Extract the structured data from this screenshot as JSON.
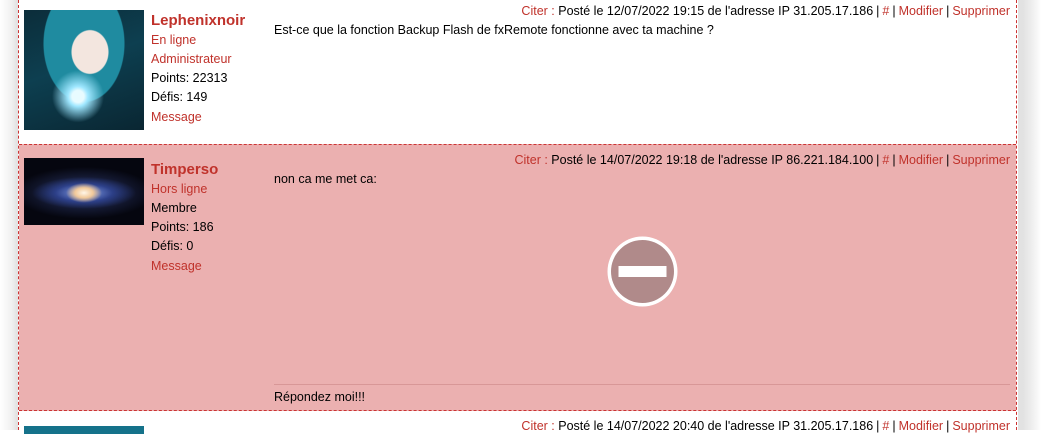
{
  "posts": [
    {
      "username": "Lephenixnoir",
      "status": "En ligne",
      "role": "Administrateur",
      "points": "Points: 22313",
      "defis": "Défis: 149",
      "message_link": "Message",
      "cite": "Citer :",
      "posted": "Posté le 12/07/2022 19:15 de l'adresse IP 31.205.17.186",
      "sep": "|",
      "hash": "#",
      "edit": "Modifier",
      "delete": "Supprimer",
      "text": "Est-ce que la fonction Backup Flash de fxRemote fonctionne avec ta machine ?"
    },
    {
      "username": "Timperso",
      "status": "Hors ligne",
      "role": "Membre",
      "points": "Points: 186",
      "defis": "Défis: 0",
      "message_link": "Message",
      "cite": "Citer :",
      "posted": "Posté le 14/07/2022 19:18 de l'adresse IP 86.221.184.100",
      "sep": "|",
      "hash": "#",
      "edit": "Modifier",
      "delete": "Supprimer",
      "text": "non ca me met ca:",
      "signature": "Répondez moi!!!"
    },
    {
      "cite": "Citer :",
      "posted": "Posté le 14/07/2022 20:40 de l'adresse IP 31.205.17.186",
      "sep": "|",
      "hash": "#",
      "edit": "Modifier",
      "delete": "Supprimer"
    }
  ],
  "colors": {
    "accent": "#c0322b",
    "highlight_bg": "#ebb0b0",
    "icon_gray": "#b08a8a"
  },
  "icons": {
    "embedded_image": "no-entry-icon"
  }
}
